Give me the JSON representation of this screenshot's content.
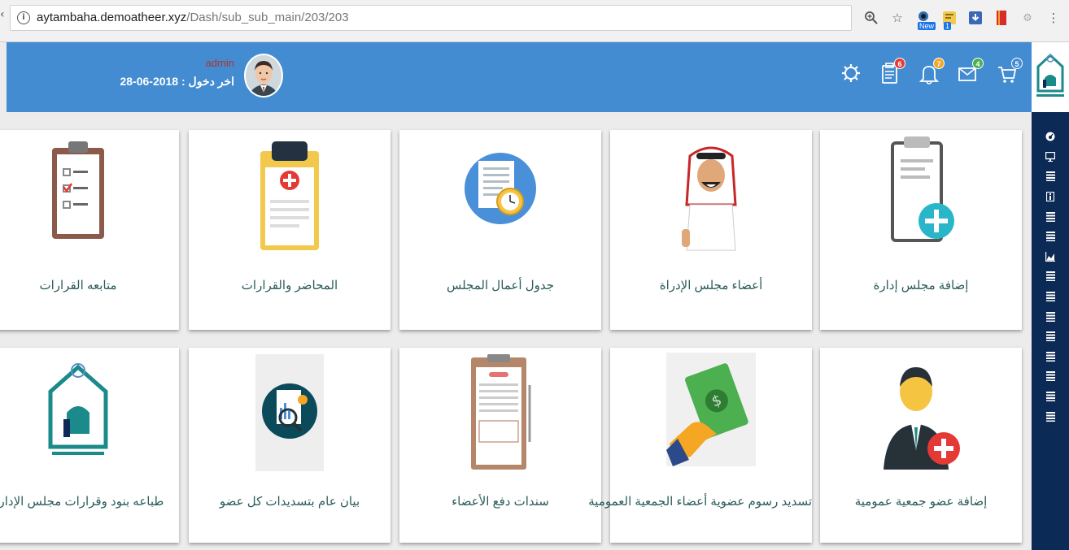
{
  "browser": {
    "url_host": "aytambaha.demoatheer.xyz",
    "url_path": "/Dash/sub_sub_main/203/203",
    "extensions": [
      {
        "name": "zoom-icon"
      },
      {
        "name": "star-icon"
      },
      {
        "name": "new-extension-icon",
        "badge": "New"
      },
      {
        "name": "extension-icon",
        "badge": "1"
      },
      {
        "name": "download-extension-icon"
      },
      {
        "name": "bookmark-extension-icon"
      },
      {
        "name": "puzzle-icon"
      },
      {
        "name": "menu-dots-icon"
      }
    ]
  },
  "header": {
    "user_name": "admin",
    "last_login": "اخر دخول : 2018-06-28",
    "icons": [
      {
        "name": "settings-icon",
        "badge": ""
      },
      {
        "name": "clipboard-icon",
        "badge": "6",
        "badge_color": "#e53935"
      },
      {
        "name": "bell-icon",
        "badge": "7",
        "badge_color": "#f5a623"
      },
      {
        "name": "mail-icon",
        "badge": "4",
        "badge_color": "#4caf50"
      },
      {
        "name": "cart-icon",
        "badge": "5",
        "badge_color": "#438cd1"
      }
    ]
  },
  "sidebar": {
    "icons": [
      "dashboard-icon",
      "monitor-icon",
      "list-icon",
      "info-icon",
      "list-icon",
      "list-icon",
      "chart-icon",
      "list-icon",
      "list-icon",
      "list-icon",
      "list-icon",
      "list-icon",
      "list-icon",
      "list-icon",
      "list-icon"
    ]
  },
  "cards": [
    {
      "label": "متابعه القرارات"
    },
    {
      "label": "المحاضر والقرارات"
    },
    {
      "label": "جدول أعمال المجلس"
    },
    {
      "label": "أعضاء مجلس الإدراة"
    },
    {
      "label": "إضافة مجلس إدارة"
    },
    {
      "label": "طباعه بنود وقرارات مجلس الإدارة"
    },
    {
      "label": "بيان عام بتسديدات كل عضو"
    },
    {
      "label": "سندات دفع الأعضاء"
    },
    {
      "label": "تسديد رسوم عضوية أعضاء الجمعية العمومية"
    },
    {
      "label": "إضافة عضو جمعية عمومية"
    }
  ],
  "colors": {
    "header": "#438cd1",
    "sidebar": "#0b2a55",
    "card_text": "#2a5c5a"
  }
}
